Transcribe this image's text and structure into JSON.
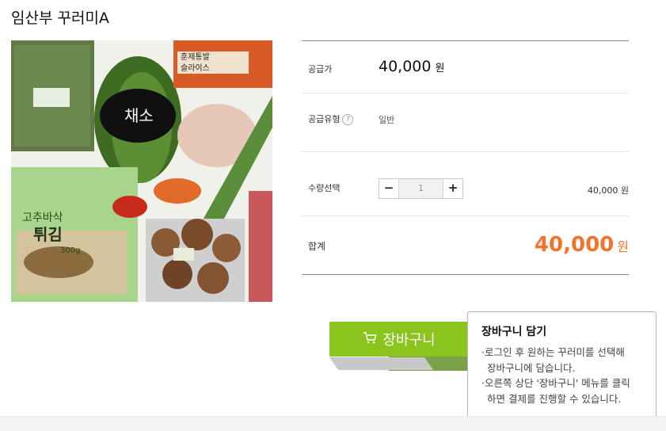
{
  "product": {
    "title": "임산부 꾸러미A",
    "image_alt": "임산부 꾸러미A 상품 이미지",
    "image_labels": [
      "채소",
      "고추바삭",
      "튀김",
      "300g",
      "훈제통발",
      "슬라이스"
    ]
  },
  "price_row": {
    "label": "공급가",
    "amount": "40,000",
    "unit": "원"
  },
  "type_row": {
    "label": "공급유형",
    "help": "?",
    "value": "일반"
  },
  "quantity_row": {
    "label": "수량선택",
    "minus": "−",
    "qty": "1",
    "plus": "+",
    "line_price": "40,000 원"
  },
  "total_row": {
    "label": "합계",
    "amount": "40,000",
    "unit": "원"
  },
  "cart_button": {
    "label": "장바구니",
    "behind_label": "",
    "icon": "cart-icon"
  },
  "tooltip": {
    "title": "장바구니 담기",
    "lines": [
      "·로그인 후 원하는 꾸러미를 선택해",
      "장바구니에 담습니다.",
      "·오른쪽 상단 '장바구니' 메뉴를 클릭",
      "하면 결제를 진행할 수 있습니다."
    ]
  },
  "colors": {
    "accent_green": "#8ac41c",
    "total_orange": "#f4722a"
  }
}
